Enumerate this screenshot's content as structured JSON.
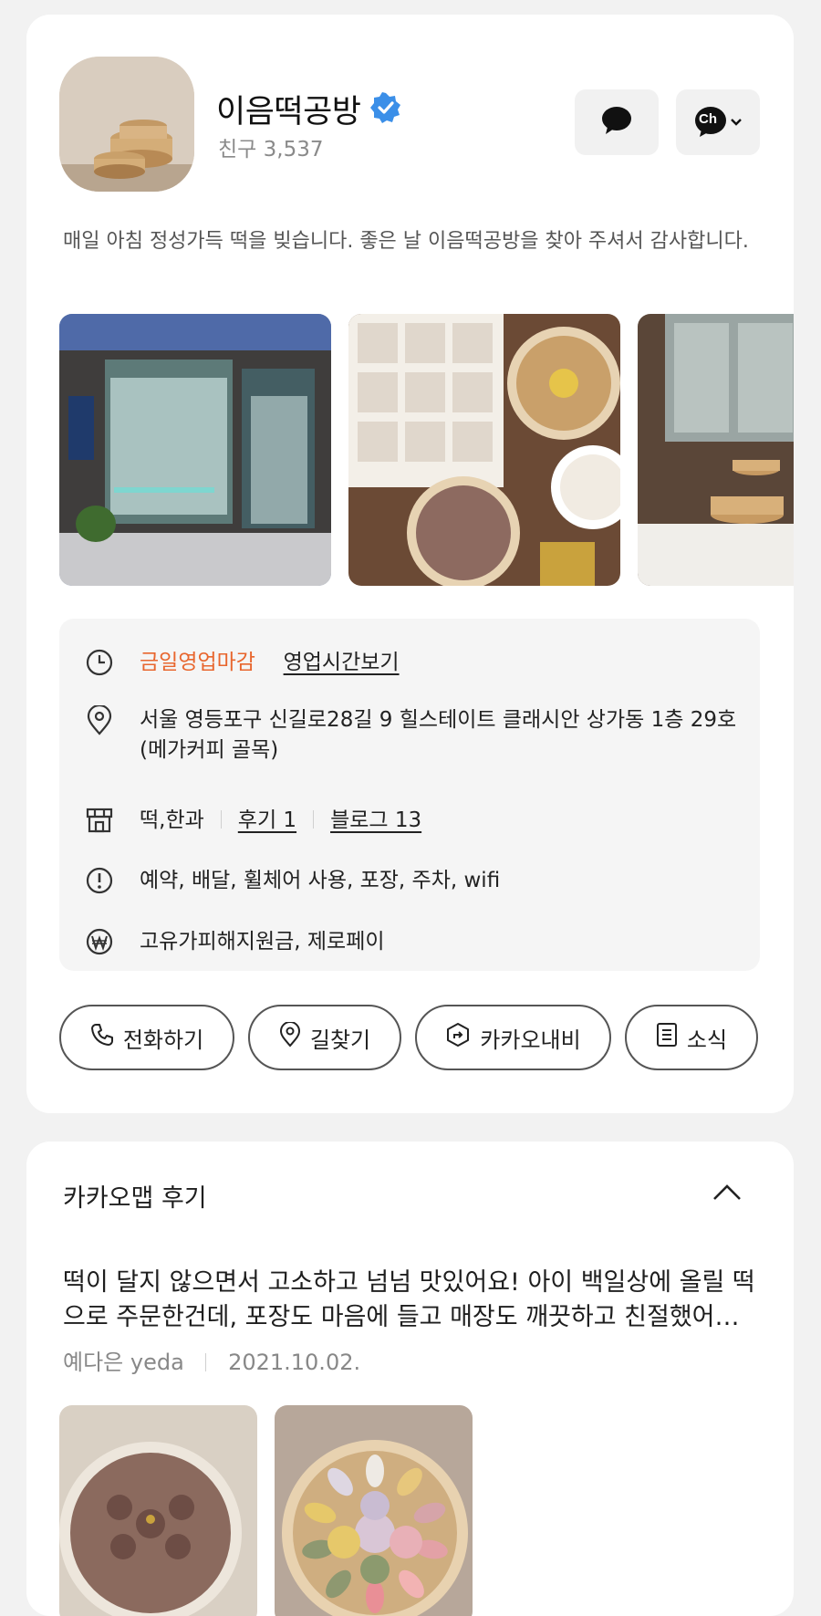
{
  "profile": {
    "name": "이음떡공방",
    "friends_label": "친구 3,537",
    "verified": true,
    "description": "매일 아침 정성가득 떡을 빚습니다. 좋은 날 이음떡공방을 찾아 주셔서 감사합니다.",
    "photos": [
      "storefront-photo",
      "rice-cake-box-photo",
      "interior-photo"
    ]
  },
  "header_buttons": {
    "chat_icon": "chat-bubble-icon",
    "channel_icon": "channel-ch-icon",
    "channel_text": "Ch"
  },
  "info": {
    "hours_status": "금일영업마감",
    "hours_link": "영업시간보기",
    "address": "서울 영등포구 신길로28길 9 힐스테이트 클래시안 상가동 1층 29호 (메가커피 골목)",
    "category": "떡,한과",
    "reviews_link": "후기 1",
    "blog_link": "블로그 13",
    "facilities": "예약, 배달, 휠체어 사용, 포장, 주차, wifi",
    "payments": "고유가피해지원금, 제로페이"
  },
  "actions": {
    "call": "전화하기",
    "directions": "길찾기",
    "navi": "카카오내비",
    "news": "소식"
  },
  "reviews": {
    "title": "카카오맵 후기",
    "text": "떡이 달지 않으면서 고소하고 넘넘 맛있어요! 아이 백일상에 올릴 떡으로 주문한건데, 포장도 마음에 들고 매장도 깨끗하고 친절했어…",
    "author": "예다은 yeda",
    "date": "2021.10.02."
  },
  "colors": {
    "accent_orange": "#e8662e",
    "verified_blue": "#3b8fe8"
  }
}
